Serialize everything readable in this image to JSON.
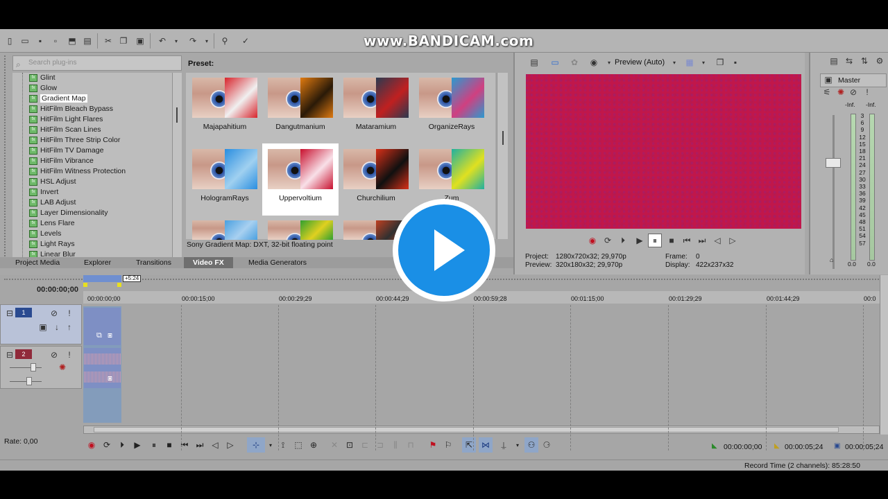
{
  "watermark": "www.BANDICAM.com",
  "toolbar": {
    "icons": [
      "new-icon",
      "open-icon",
      "save-icon",
      "save-as-icon",
      "render-icon",
      "properties-icon",
      "cut-icon",
      "copy-icon",
      "paste-icon",
      "undo-icon",
      "redo-icon",
      "snap-icon",
      "tools-icon"
    ]
  },
  "plugins": {
    "search_placeholder": "Search plug-ins",
    "items": [
      {
        "label": "Glint",
        "selected": false
      },
      {
        "label": "Glow",
        "selected": false
      },
      {
        "label": "Gradient Map",
        "selected": true
      },
      {
        "label": "HitFilm Bleach Bypass",
        "selected": false
      },
      {
        "label": "HitFilm Light Flares",
        "selected": false
      },
      {
        "label": "HitFilm Scan Lines",
        "selected": false
      },
      {
        "label": "HitFilm Three Strip Color",
        "selected": false
      },
      {
        "label": "HitFilm TV Damage",
        "selected": false
      },
      {
        "label": "HitFilm Vibrance",
        "selected": false
      },
      {
        "label": "HitFilm Witness Protection",
        "selected": false
      },
      {
        "label": "HSL Adjust",
        "selected": false
      },
      {
        "label": "Invert",
        "selected": false
      },
      {
        "label": "LAB Adjust",
        "selected": false
      },
      {
        "label": "Layer Dimensionality",
        "selected": false
      },
      {
        "label": "Lens Flare",
        "selected": false
      },
      {
        "label": "Levels",
        "selected": false
      },
      {
        "label": "Light Rays",
        "selected": false
      },
      {
        "label": "Linear Blur",
        "selected": false
      }
    ]
  },
  "presets": {
    "title": "Preset:",
    "items": [
      {
        "label": "Majapahitium",
        "tint": "#d8242c",
        "tint2": "#f0f0f0"
      },
      {
        "label": "Dangutmanium",
        "tint": "#e07a10",
        "tint2": "#2a1a08"
      },
      {
        "label": "Mataramium",
        "tint": "#2a3a50",
        "tint2": "#c02020"
      },
      {
        "label": "OrganizeRays",
        "tint": "#2a9ad0",
        "tint2": "#d04080"
      },
      {
        "label": "HologramRays",
        "tint": "#2a8ee0",
        "tint2": "#a0d0f0"
      },
      {
        "label": "Uppervoltium",
        "tint": "#c8102e",
        "tint2": "#f8e0e8"
      },
      {
        "label": "Churchilium",
        "tint": "#d83018",
        "tint2": "#101010"
      },
      {
        "label": "Zum",
        "tint": "#20b0a0",
        "tint2": "#e0e020"
      },
      {
        "label": "",
        "tint": "#4aa0e0",
        "tint2": "#a8d0f0"
      },
      {
        "label": "",
        "tint": "#30a030",
        "tint2": "#e0d020"
      },
      {
        "label": "",
        "tint": "#c04020",
        "tint2": "#303030"
      }
    ],
    "status": "Sony Gradient Map: DXT, 32-bit floating point"
  },
  "tabs": [
    "Project Media",
    "Explorer",
    "Transitions",
    "Video FX",
    "Media Generators"
  ],
  "active_tab": "Video FX",
  "preview": {
    "mode": "Preview (Auto)",
    "project_label": "Project:",
    "project_value": "1280x720x32; 29,970p",
    "preview_label": "Preview:",
    "preview_value": "320x180x32; 29,970p",
    "frame_label": "Frame:",
    "frame_value": "0",
    "display_label": "Display:",
    "display_value": "422x237x32"
  },
  "mixer": {
    "title": "Master",
    "inf_left": "-Inf.",
    "inf_right": "-Inf.",
    "scale": [
      "3",
      "6",
      "9",
      "12",
      "15",
      "18",
      "21",
      "24",
      "27",
      "30",
      "33",
      "36",
      "39",
      "42",
      "45",
      "48",
      "51",
      "54",
      "57"
    ],
    "value_left": "0.0",
    "value_right": "0.0"
  },
  "timeline": {
    "current_time": "00:00:00;00",
    "region_length": "+5:24",
    "ruler": [
      "00:00:00;00",
      "00:00:15;00",
      "00:00:29;29",
      "00:00:44;29",
      "00:00:59;28",
      "00:01:15;00",
      "00:01:29;29",
      "00:01:44;29",
      "00:0"
    ],
    "tracks": [
      {
        "number": "1",
        "type": "video"
      },
      {
        "number": "2",
        "type": "audio"
      }
    ]
  },
  "transport": {
    "time_start": "00:00:00;00",
    "time_end": "00:00:05;24",
    "time_length": "00:00:05;24"
  },
  "status": {
    "rate": "Rate: 0,00",
    "record_time": "Record Time (2 channels): 85:28:50"
  }
}
